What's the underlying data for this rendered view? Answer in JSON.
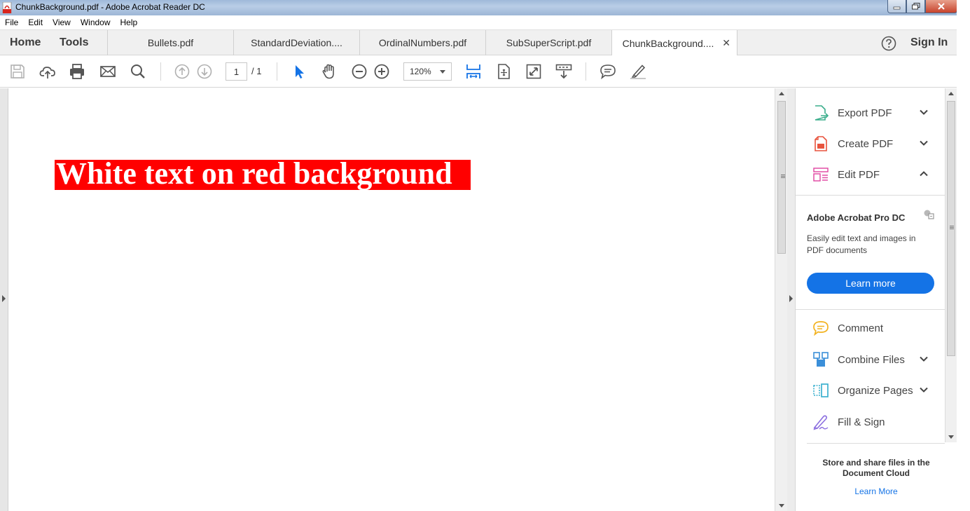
{
  "window": {
    "title": "ChunkBackground.pdf - Adobe Acrobat Reader DC"
  },
  "menu": [
    "File",
    "Edit",
    "View",
    "Window",
    "Help"
  ],
  "nav": {
    "home": "Home",
    "tools": "Tools",
    "sign_in": "Sign In"
  },
  "tabs": [
    {
      "label": "Bullets.pdf",
      "active": false
    },
    {
      "label": "StandardDeviation....",
      "active": false
    },
    {
      "label": "OrdinalNumbers.pdf",
      "active": false
    },
    {
      "label": "SubSuperScript.pdf",
      "active": false
    },
    {
      "label": "ChunkBackground....",
      "active": true
    }
  ],
  "toolbar": {
    "page_current": "1",
    "page_total": "/ 1",
    "zoom": "120%",
    "accent": "#1473e6"
  },
  "document": {
    "text": "White text on red background",
    "text_color": "#ffffff",
    "background_color": "#ff0000"
  },
  "right_pane": {
    "tools": [
      {
        "label": "Export PDF",
        "icon": "export-pdf-icon",
        "chevron": "down"
      },
      {
        "label": "Create PDF",
        "icon": "create-pdf-icon",
        "chevron": "down"
      },
      {
        "label": "Edit PDF",
        "icon": "edit-pdf-icon",
        "chevron": "up"
      }
    ],
    "promo": {
      "title": "Adobe Acrobat Pro DC",
      "description": "Easily edit text and images in PDF documents",
      "button": "Learn more"
    },
    "more_tools": [
      {
        "label": "Comment",
        "icon": "comment-icon",
        "chevron": ""
      },
      {
        "label": "Combine Files",
        "icon": "combine-files-icon",
        "chevron": "down"
      },
      {
        "label": "Organize Pages",
        "icon": "organize-pages-icon",
        "chevron": "down"
      },
      {
        "label": "Fill & Sign",
        "icon": "fill-sign-icon",
        "chevron": ""
      }
    ],
    "cloud": {
      "text": "Store and share files in the Document Cloud",
      "link": "Learn More"
    }
  }
}
